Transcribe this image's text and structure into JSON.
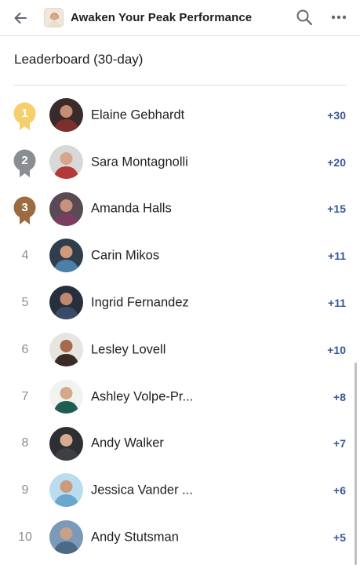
{
  "header": {
    "group_title": "Awaken Your Peak Performance",
    "back_icon": "arrow-left-icon",
    "search_icon": "search-icon",
    "more_icon": "more-horizontal-icon"
  },
  "leaderboard": {
    "title": "Leaderboard (30-day)",
    "entries": [
      {
        "rank": "1",
        "name": "Elaine Gebhardt",
        "points": "+30",
        "medal": "gold"
      },
      {
        "rank": "2",
        "name": "Sara Montagnolli",
        "points": "+20",
        "medal": "silver"
      },
      {
        "rank": "3",
        "name": "Amanda Halls",
        "points": "+15",
        "medal": "bronze"
      },
      {
        "rank": "4",
        "name": "Carin Mikos",
        "points": "+11"
      },
      {
        "rank": "5",
        "name": "Ingrid Fernandez",
        "points": "+11"
      },
      {
        "rank": "6",
        "name": "Lesley Lovell",
        "points": "+10"
      },
      {
        "rank": "7",
        "name": "Ashley Volpe-Pr...",
        "points": "+8"
      },
      {
        "rank": "8",
        "name": "Andy Walker",
        "points": "+7"
      },
      {
        "rank": "9",
        "name": "Jessica Vander ...",
        "points": "+6"
      },
      {
        "rank": "10",
        "name": "Andy Stutsman",
        "points": "+5"
      }
    ]
  },
  "colors": {
    "gold": "#f5cf6c",
    "silver": "#8a8d91",
    "bronze": "#9c6b42",
    "points": "#385898"
  }
}
